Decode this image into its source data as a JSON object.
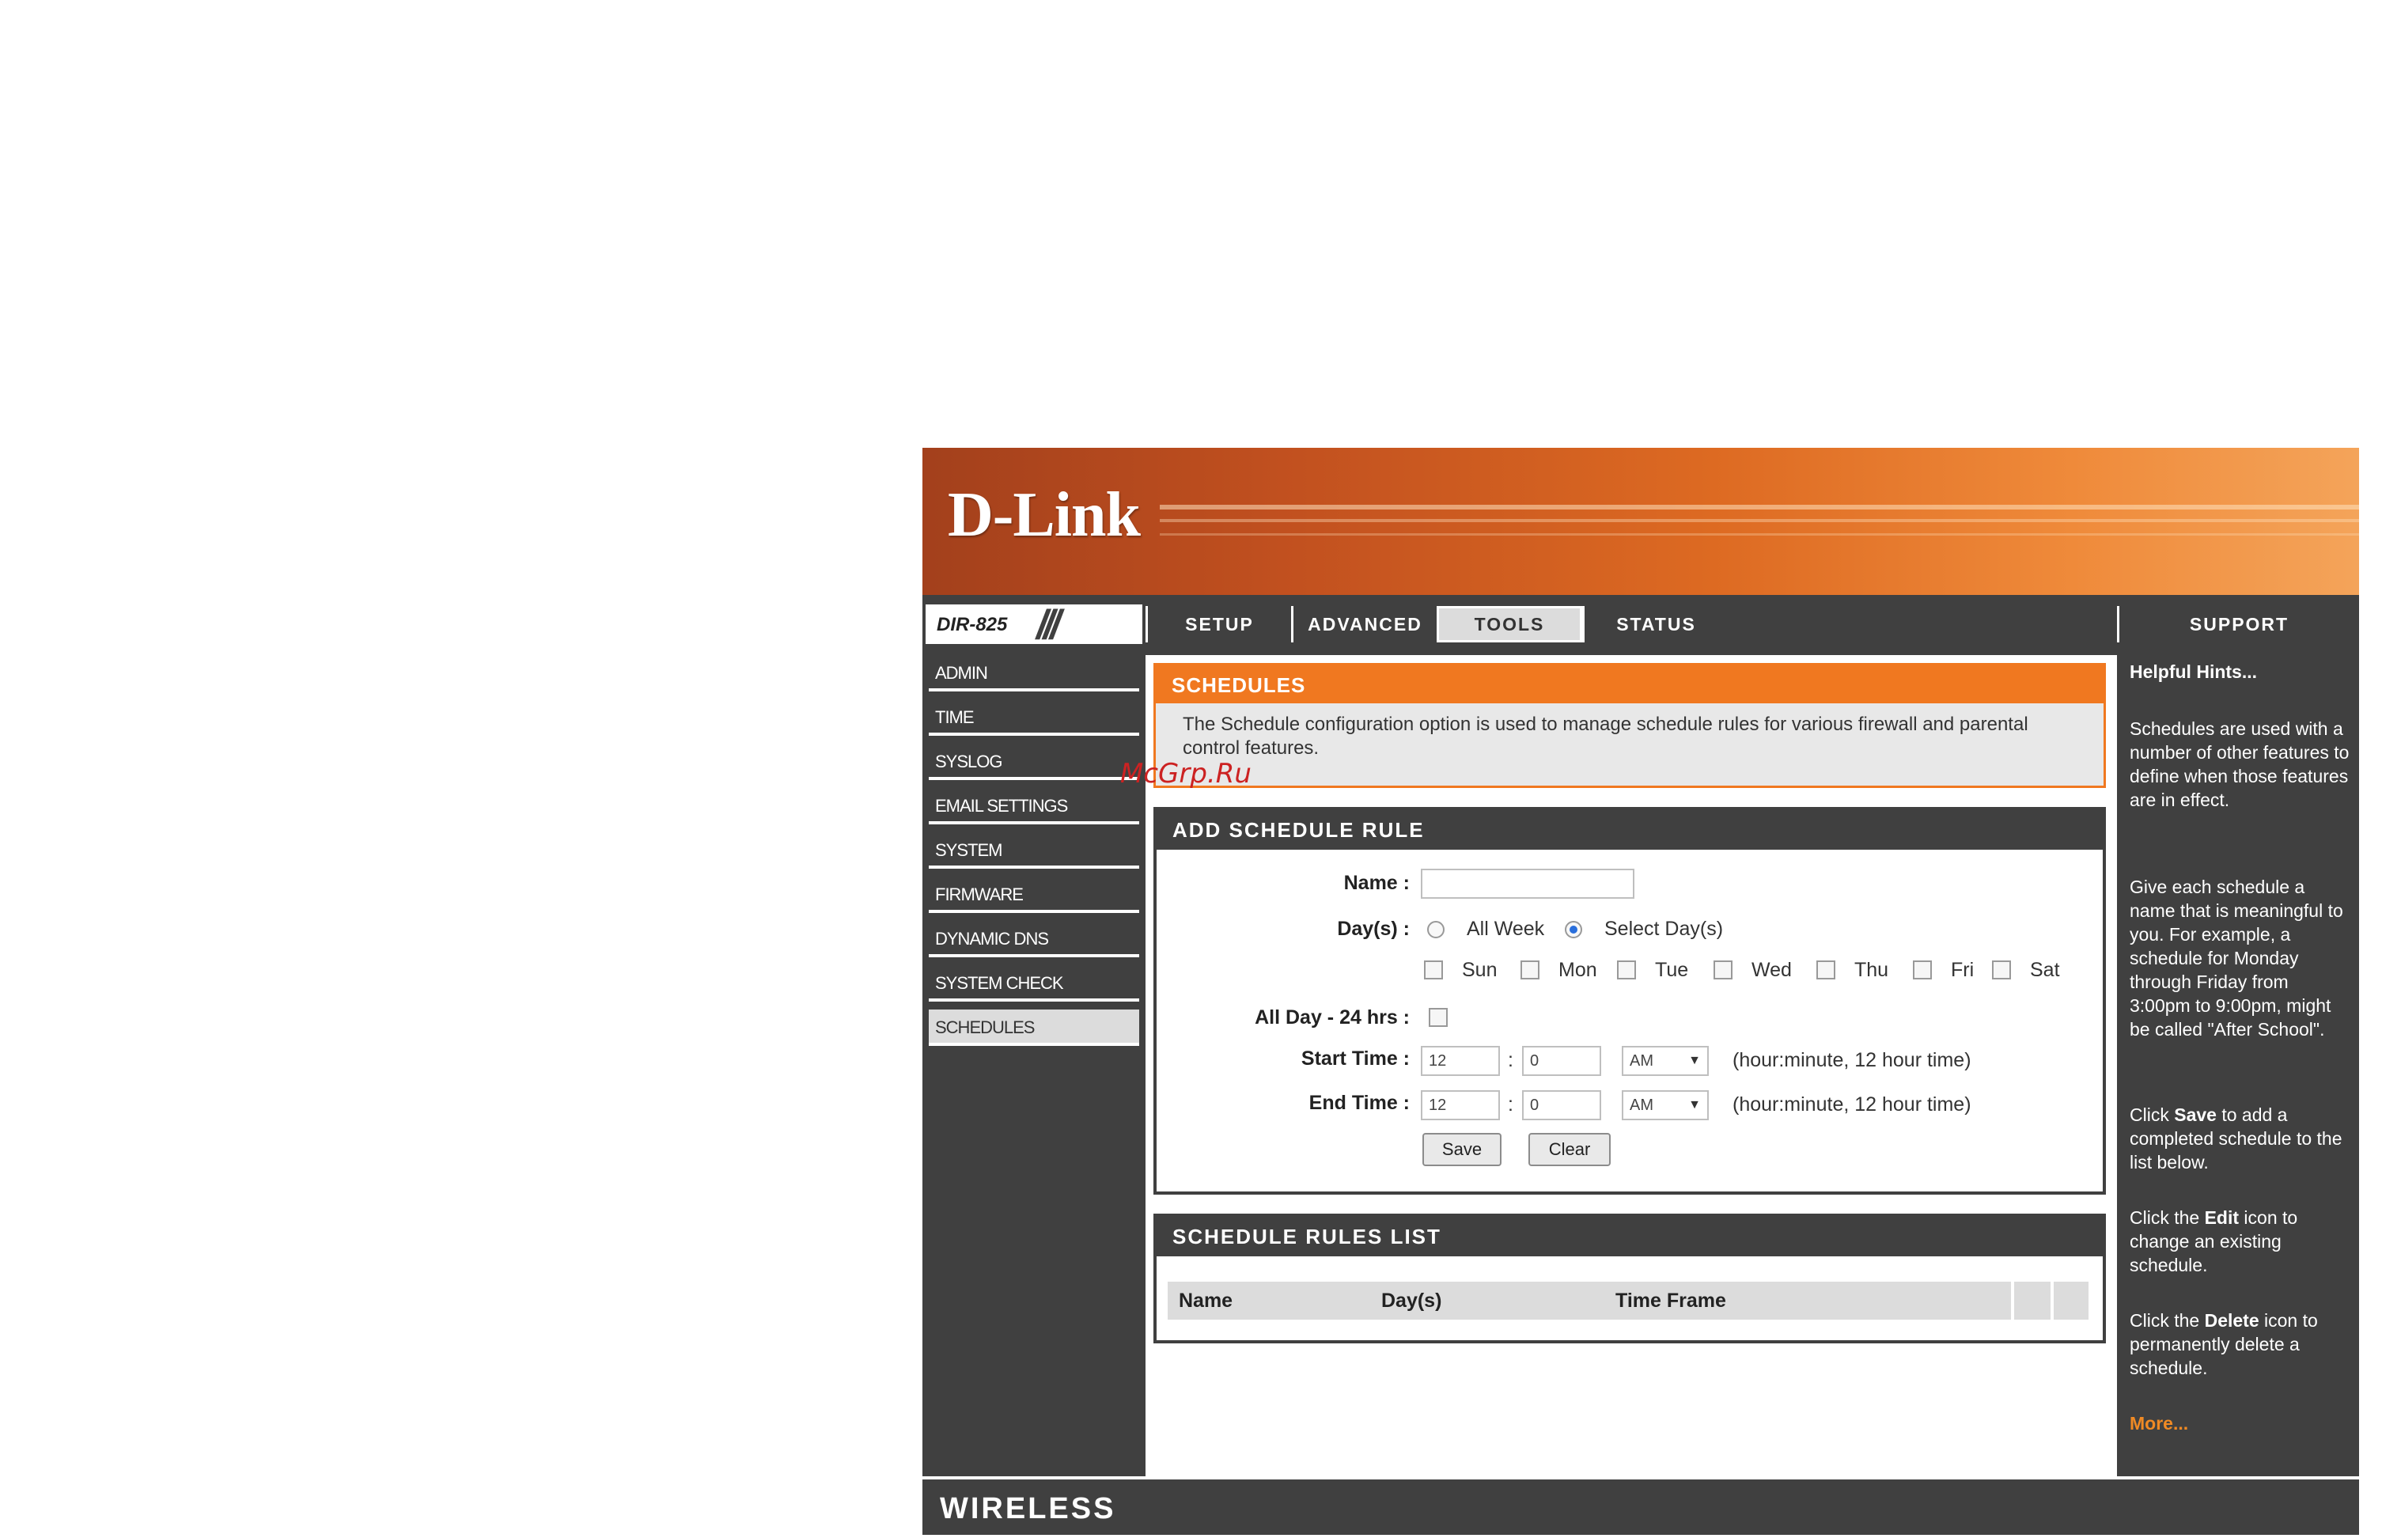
{
  "banner": {
    "logo": "D-Link"
  },
  "nav": {
    "model": "DIR-825",
    "tabs": [
      {
        "label": "SETUP"
      },
      {
        "label": "ADVANCED"
      },
      {
        "label": "TOOLS"
      },
      {
        "label": "STATUS"
      },
      {
        "label": "SUPPORT"
      }
    ],
    "active_tab": "TOOLS"
  },
  "sidebar": {
    "items": [
      {
        "label": "ADMIN"
      },
      {
        "label": "TIME"
      },
      {
        "label": "SYSLOG"
      },
      {
        "label": "EMAIL SETTINGS"
      },
      {
        "label": "SYSTEM"
      },
      {
        "label": "FIRMWARE"
      },
      {
        "label": "DYNAMIC DNS"
      },
      {
        "label": "SYSTEM CHECK"
      },
      {
        "label": "SCHEDULES"
      }
    ],
    "active_item": "SCHEDULES"
  },
  "schedules": {
    "title": "SCHEDULES",
    "description": "The Schedule configuration option is used to manage schedule rules for various firewall and parental control features."
  },
  "watermark": "McGrp.Ru",
  "add_rule": {
    "title": "ADD SCHEDULE RULE",
    "name_label": "Name :",
    "name_value": "",
    "days_label": "Day(s) :",
    "all_week_label": "All Week",
    "select_days_label": "Select Day(s)",
    "days_selection": "Select Day(s)",
    "days": [
      "Sun",
      "Mon",
      "Tue",
      "Wed",
      "Thu",
      "Fri",
      "Sat"
    ],
    "all_day_label": "All Day - 24 hrs :",
    "start_time_label": "Start Time :",
    "end_time_label": "End Time :",
    "start_hour": "12",
    "start_minute": "0",
    "start_ampm": "AM",
    "end_hour": "12",
    "end_minute": "0",
    "end_ampm": "AM",
    "colon": ":",
    "time_hint": "(hour:minute, 12 hour time)",
    "save_label": "Save",
    "clear_label": "Clear"
  },
  "rules_list": {
    "title": "SCHEDULE RULES LIST",
    "columns": [
      "Name",
      "Day(s)",
      "Time Frame"
    ]
  },
  "hints": {
    "title": "Helpful Hints...",
    "p1": "Schedules are used with a number of other features to define when those features are in effect.",
    "p2": "Give each schedule a name that is meaningful to you. For example, a schedule for Monday through Friday from 3:00pm to 9:00pm, might be called \"After School\".",
    "p3_pre": "Click ",
    "p3_bold": "Save",
    "p3_post": " to add a completed schedule to the list below.",
    "p4_pre": "Click the ",
    "p4_bold": "Edit",
    "p4_post": " icon to change an existing schedule.",
    "p5_pre": "Click the ",
    "p5_bold": "Delete",
    "p5_post": " icon to permanently delete a schedule.",
    "more": "More..."
  },
  "footer": {
    "label": "WIRELESS"
  },
  "colors": {
    "accent": "#f07820",
    "dark": "#404040",
    "active_tab": "#dcdcdc"
  }
}
